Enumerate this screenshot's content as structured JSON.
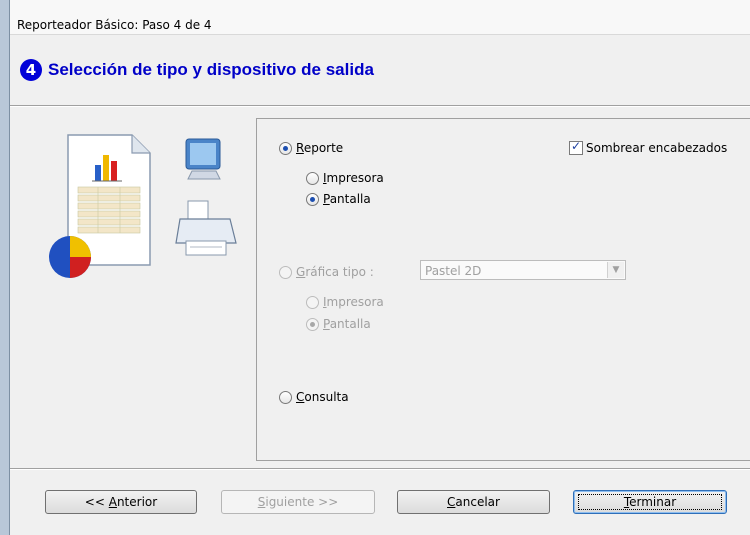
{
  "window": {
    "title": "Reporteador Básico: Paso 4 de 4"
  },
  "heading": {
    "step_number": "4",
    "text": "Selección de tipo y dispositivo de salida"
  },
  "options": {
    "reporte": {
      "label": "Reporte",
      "mnemonic": "R",
      "rest": "eporte",
      "selected": true
    },
    "reporte_impresora": {
      "label": "Impresora",
      "mnemonic": "I",
      "rest": "mpresora",
      "selected": false
    },
    "reporte_pantalla": {
      "label": "Pantalla",
      "mnemonic": "P",
      "rest": "antalla",
      "selected": true
    },
    "sombrear": {
      "label": "Sombrear encabezados",
      "checked": true
    },
    "grafica": {
      "label": "Gráfica tipo :",
      "mnemonic": "G",
      "rest": "ráfica tipo :",
      "selected": false,
      "enabled": false
    },
    "grafica_select": {
      "value": "Pastel 2D"
    },
    "grafica_impresora": {
      "label": "Impresora",
      "mnemonic": "I",
      "rest": "mpresora",
      "selected": false,
      "enabled": false
    },
    "grafica_pantalla": {
      "label": "Pantalla",
      "mnemonic": "P",
      "rest": "antalla",
      "selected": true,
      "enabled": false
    },
    "consulta": {
      "label": "Consulta",
      "mnemonic": "C",
      "rest": "onsulta",
      "selected": false
    }
  },
  "buttons": {
    "anterior": {
      "prefix": "<< ",
      "mnemonic": "A",
      "rest": "nterior"
    },
    "siguiente": {
      "mnemonic": "S",
      "rest": "iguiente >>",
      "enabled": false
    },
    "cancelar": {
      "mnemonic": "C",
      "rest": "ancelar"
    },
    "terminar": {
      "mnemonic": "T",
      "rest": "erminar"
    }
  },
  "icons": [
    "report-document-icon",
    "bar-chart-icon",
    "pie-chart-icon",
    "monitor-icon",
    "printer-icon",
    "chevron-down-icon"
  ],
  "colors": {
    "heading": "#0000c8",
    "step_circle": "#0000d8",
    "selected_radio": "#1d4fb0"
  }
}
